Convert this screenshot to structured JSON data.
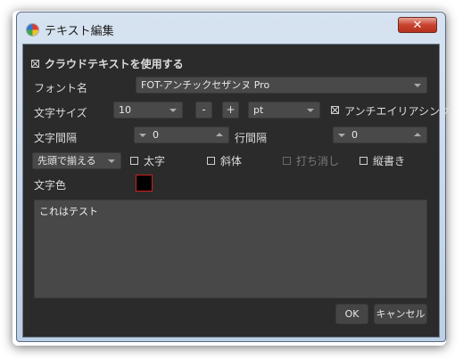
{
  "window": {
    "title": "テキスト編集",
    "close_symbol": "✕"
  },
  "cloud_text": {
    "label": "クラウドテキストを使用する",
    "checked": true
  },
  "font_name": {
    "label": "フォント名",
    "value": "FOT-アンチックセザンヌ Pro"
  },
  "font_size": {
    "label": "文字サイズ",
    "value": "10",
    "minus": "-",
    "plus": "+",
    "unit": "pt",
    "antialias_label": "アンチエイリアシング",
    "antialias_checked": true
  },
  "char_spacing": {
    "label": "文字間隔",
    "value": "0"
  },
  "line_spacing": {
    "label": "行間隔",
    "value": "0"
  },
  "alignment": {
    "value": "先頭で揃える"
  },
  "styles": {
    "bold": {
      "label": "太字",
      "checked": false
    },
    "italic": {
      "label": "斜体",
      "checked": false
    },
    "strike": {
      "label": "打ち消し",
      "checked": false,
      "disabled": true
    },
    "vertical": {
      "label": "縦書き",
      "checked": false
    }
  },
  "text_color": {
    "label": "文字色",
    "color": "#000000",
    "border": "#d02020"
  },
  "text_content": "これはテスト",
  "buttons": {
    "ok": "OK",
    "cancel": "キャンセル"
  }
}
